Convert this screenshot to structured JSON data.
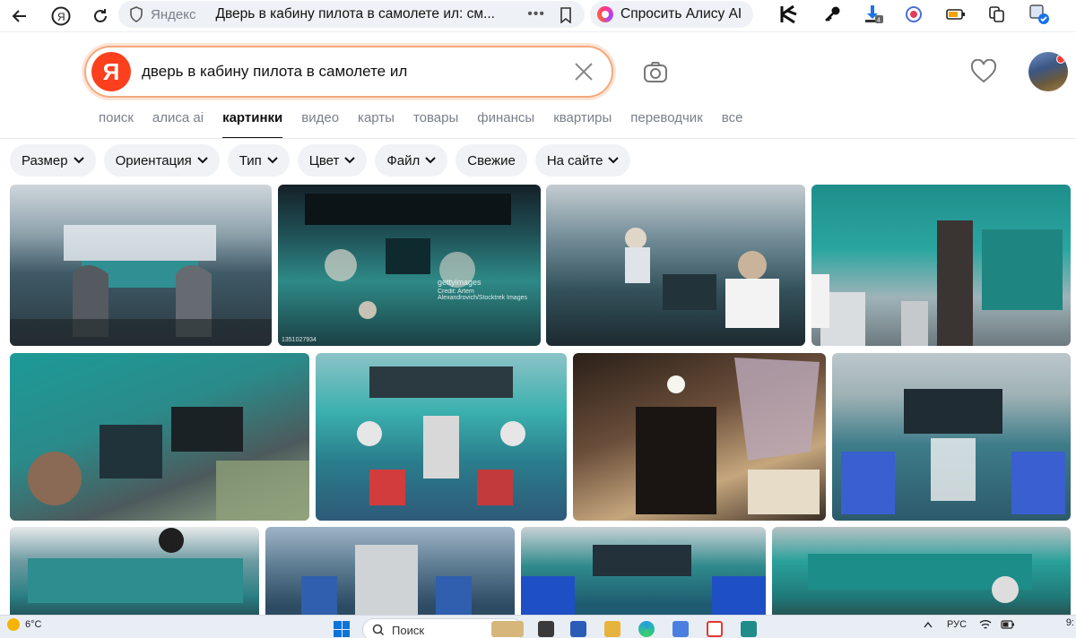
{
  "browser": {
    "site_name": "Яндекс",
    "page_title": "Дверь в кабину пилота в самолете ил: см...",
    "more_label": "•••",
    "alice_label": "Спросить Алису AI"
  },
  "search": {
    "logo_letter": "Я",
    "query": "дверь в кабину пилота в самолете ил"
  },
  "tabs": [
    {
      "label": "поиск",
      "active": false
    },
    {
      "label": "алиса ai",
      "active": false
    },
    {
      "label": "картинки",
      "active": true
    },
    {
      "label": "видео",
      "active": false
    },
    {
      "label": "карты",
      "active": false
    },
    {
      "label": "товары",
      "active": false
    },
    {
      "label": "финансы",
      "active": false
    },
    {
      "label": "квартиры",
      "active": false
    },
    {
      "label": "переводчик",
      "active": false
    },
    {
      "label": "все",
      "active": false
    }
  ],
  "filters": [
    {
      "label": "Размер",
      "dropdown": true
    },
    {
      "label": "Ориентация",
      "dropdown": true
    },
    {
      "label": "Тип",
      "dropdown": true
    },
    {
      "label": "Цвет",
      "dropdown": true
    },
    {
      "label": "Файл",
      "dropdown": true
    },
    {
      "label": "Свежие",
      "dropdown": false
    },
    {
      "label": "На сайте",
      "dropdown": true
    }
  ],
  "images": {
    "watermark_getty": "gettyimages",
    "watermark_credit": "Credit: Artem Alexandrovich/Stocktrek Images",
    "getty_id": "1351027934"
  },
  "taskbar": {
    "temperature": "6°C",
    "search_label": "Поиск",
    "language": "РУС",
    "time": "9:"
  },
  "colors": {
    "accent_red": "#fc3f1d",
    "cockpit_teal": "#2a9d99",
    "search_border": "#f2a97e"
  }
}
